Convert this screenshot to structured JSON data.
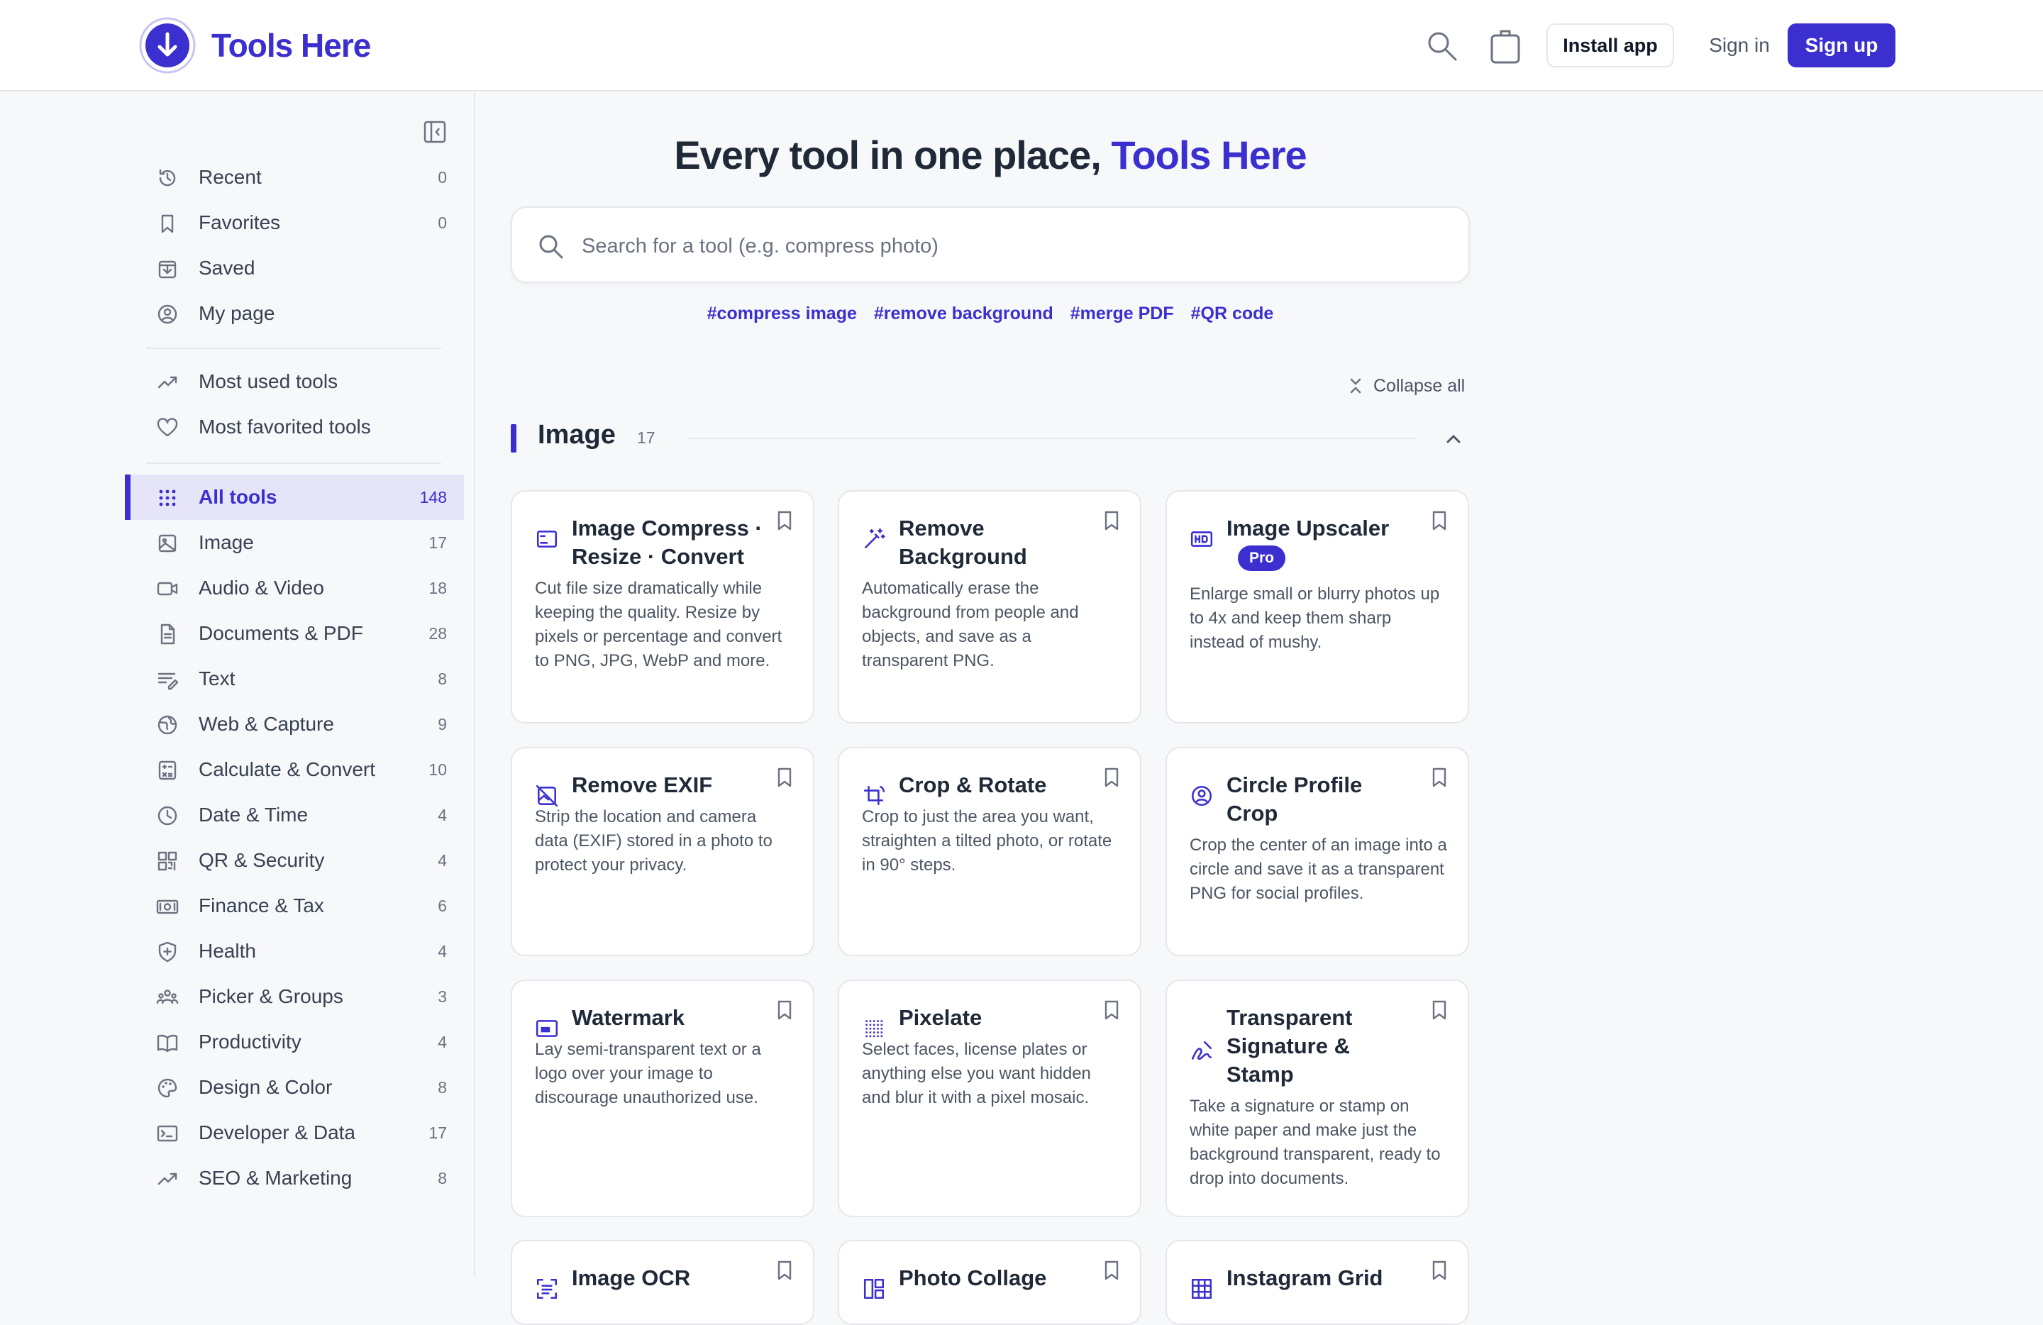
{
  "brand": {
    "name": "Tools Here",
    "accent_color": "#3b2fcf"
  },
  "header": {
    "install_label": "Install app",
    "signin_label": "Sign in",
    "signup_label": "Sign up"
  },
  "sidebar": {
    "items": [
      {
        "label": "Recent",
        "count": "0",
        "icon": "history-icon"
      },
      {
        "label": "Favorites",
        "count": "0",
        "icon": "bookmark-icon"
      },
      {
        "label": "Saved",
        "count": "",
        "icon": "download-box-icon"
      },
      {
        "label": "My page",
        "count": "",
        "icon": "user-circle-icon"
      },
      {
        "label": "Most used tools",
        "count": "",
        "icon": "trending-up-icon"
      },
      {
        "label": "Most favorited tools",
        "count": "",
        "icon": "heart-icon"
      },
      {
        "label": "All tools",
        "count": "148",
        "icon": "grid-dots-icon",
        "active": true
      },
      {
        "label": "Image",
        "count": "17",
        "icon": "image-icon"
      },
      {
        "label": "Audio & Video",
        "count": "18",
        "icon": "video-icon"
      },
      {
        "label": "Documents & PDF",
        "count": "28",
        "icon": "document-icon"
      },
      {
        "label": "Text",
        "count": "8",
        "icon": "text-edit-icon"
      },
      {
        "label": "Web & Capture",
        "count": "9",
        "icon": "globe-icon"
      },
      {
        "label": "Calculate & Convert",
        "count": "10",
        "icon": "calculator-icon"
      },
      {
        "label": "Date & Time",
        "count": "4",
        "icon": "clock-icon"
      },
      {
        "label": "QR & Security",
        "count": "4",
        "icon": "qr-code-icon"
      },
      {
        "label": "Finance & Tax",
        "count": "6",
        "icon": "money-icon"
      },
      {
        "label": "Health",
        "count": "4",
        "icon": "shield-plus-icon"
      },
      {
        "label": "Picker & Groups",
        "count": "3",
        "icon": "group-icon"
      },
      {
        "label": "Productivity",
        "count": "4",
        "icon": "book-open-icon"
      },
      {
        "label": "Design & Color",
        "count": "8",
        "icon": "palette-icon"
      },
      {
        "label": "Developer & Data",
        "count": "17",
        "icon": "terminal-icon"
      },
      {
        "label": "SEO & Marketing",
        "count": "8",
        "icon": "trending-up-icon"
      }
    ]
  },
  "main": {
    "hero_prefix": "Every tool in one place, ",
    "hero_accent": "Tools Here",
    "search_placeholder": "Search for a tool (e.g. compress photo)",
    "tags": [
      "#compress image",
      "#remove background",
      "#merge PDF",
      "#QR code"
    ],
    "collapse_all_label": "Collapse all",
    "section": {
      "title": "Image",
      "count": "17"
    },
    "cards": [
      {
        "title": "Image Compress · Resize · Convert",
        "desc": "Cut file size dramatically while keeping the quality. Resize by pixels or percentage and convert to PNG, JPG, WebP and more.",
        "icon": "image-frame-icon"
      },
      {
        "title": "Remove Background",
        "desc": "Automatically erase the background from people and objects, and save as a transparent PNG.",
        "icon": "magic-wand-icon"
      },
      {
        "title": "Image Upscaler",
        "badge": "Pro",
        "desc": "Enlarge small or blurry photos up to 4x and keep them sharp instead of mushy.",
        "icon": "hd-icon"
      },
      {
        "title": "Remove EXIF",
        "desc": "Strip the location and camera data (EXIF) stored in a photo to protect your privacy.",
        "icon": "image-off-icon"
      },
      {
        "title": "Crop & Rotate",
        "desc": "Crop to just the area you want, straighten a tilted photo, or rotate in 90° steps.",
        "icon": "crop-rotate-icon"
      },
      {
        "title": "Circle Profile Crop",
        "desc": "Crop the center of an image into a circle and save it as a transparent PNG for social profiles.",
        "icon": "user-circle-icon"
      },
      {
        "title": "Watermark",
        "desc": "Lay semi-transparent text or a logo over your image to discourage unauthorized use.",
        "icon": "watermark-icon"
      },
      {
        "title": "Pixelate",
        "desc": "Select faces, license plates or anything else you want hidden and blur it with a pixel mosaic.",
        "icon": "pixel-grid-icon"
      },
      {
        "title": "Transparent Signature & Stamp",
        "desc": "Take a signature or stamp on white paper and make just the background transparent, ready to drop into documents.",
        "icon": "signature-icon"
      },
      {
        "title": "Image OCR",
        "desc": "",
        "icon": "scan-text-icon"
      },
      {
        "title": "Photo Collage",
        "desc": "",
        "icon": "collage-icon"
      },
      {
        "title": "Instagram Grid",
        "desc": "",
        "icon": "grid-icon"
      }
    ]
  }
}
